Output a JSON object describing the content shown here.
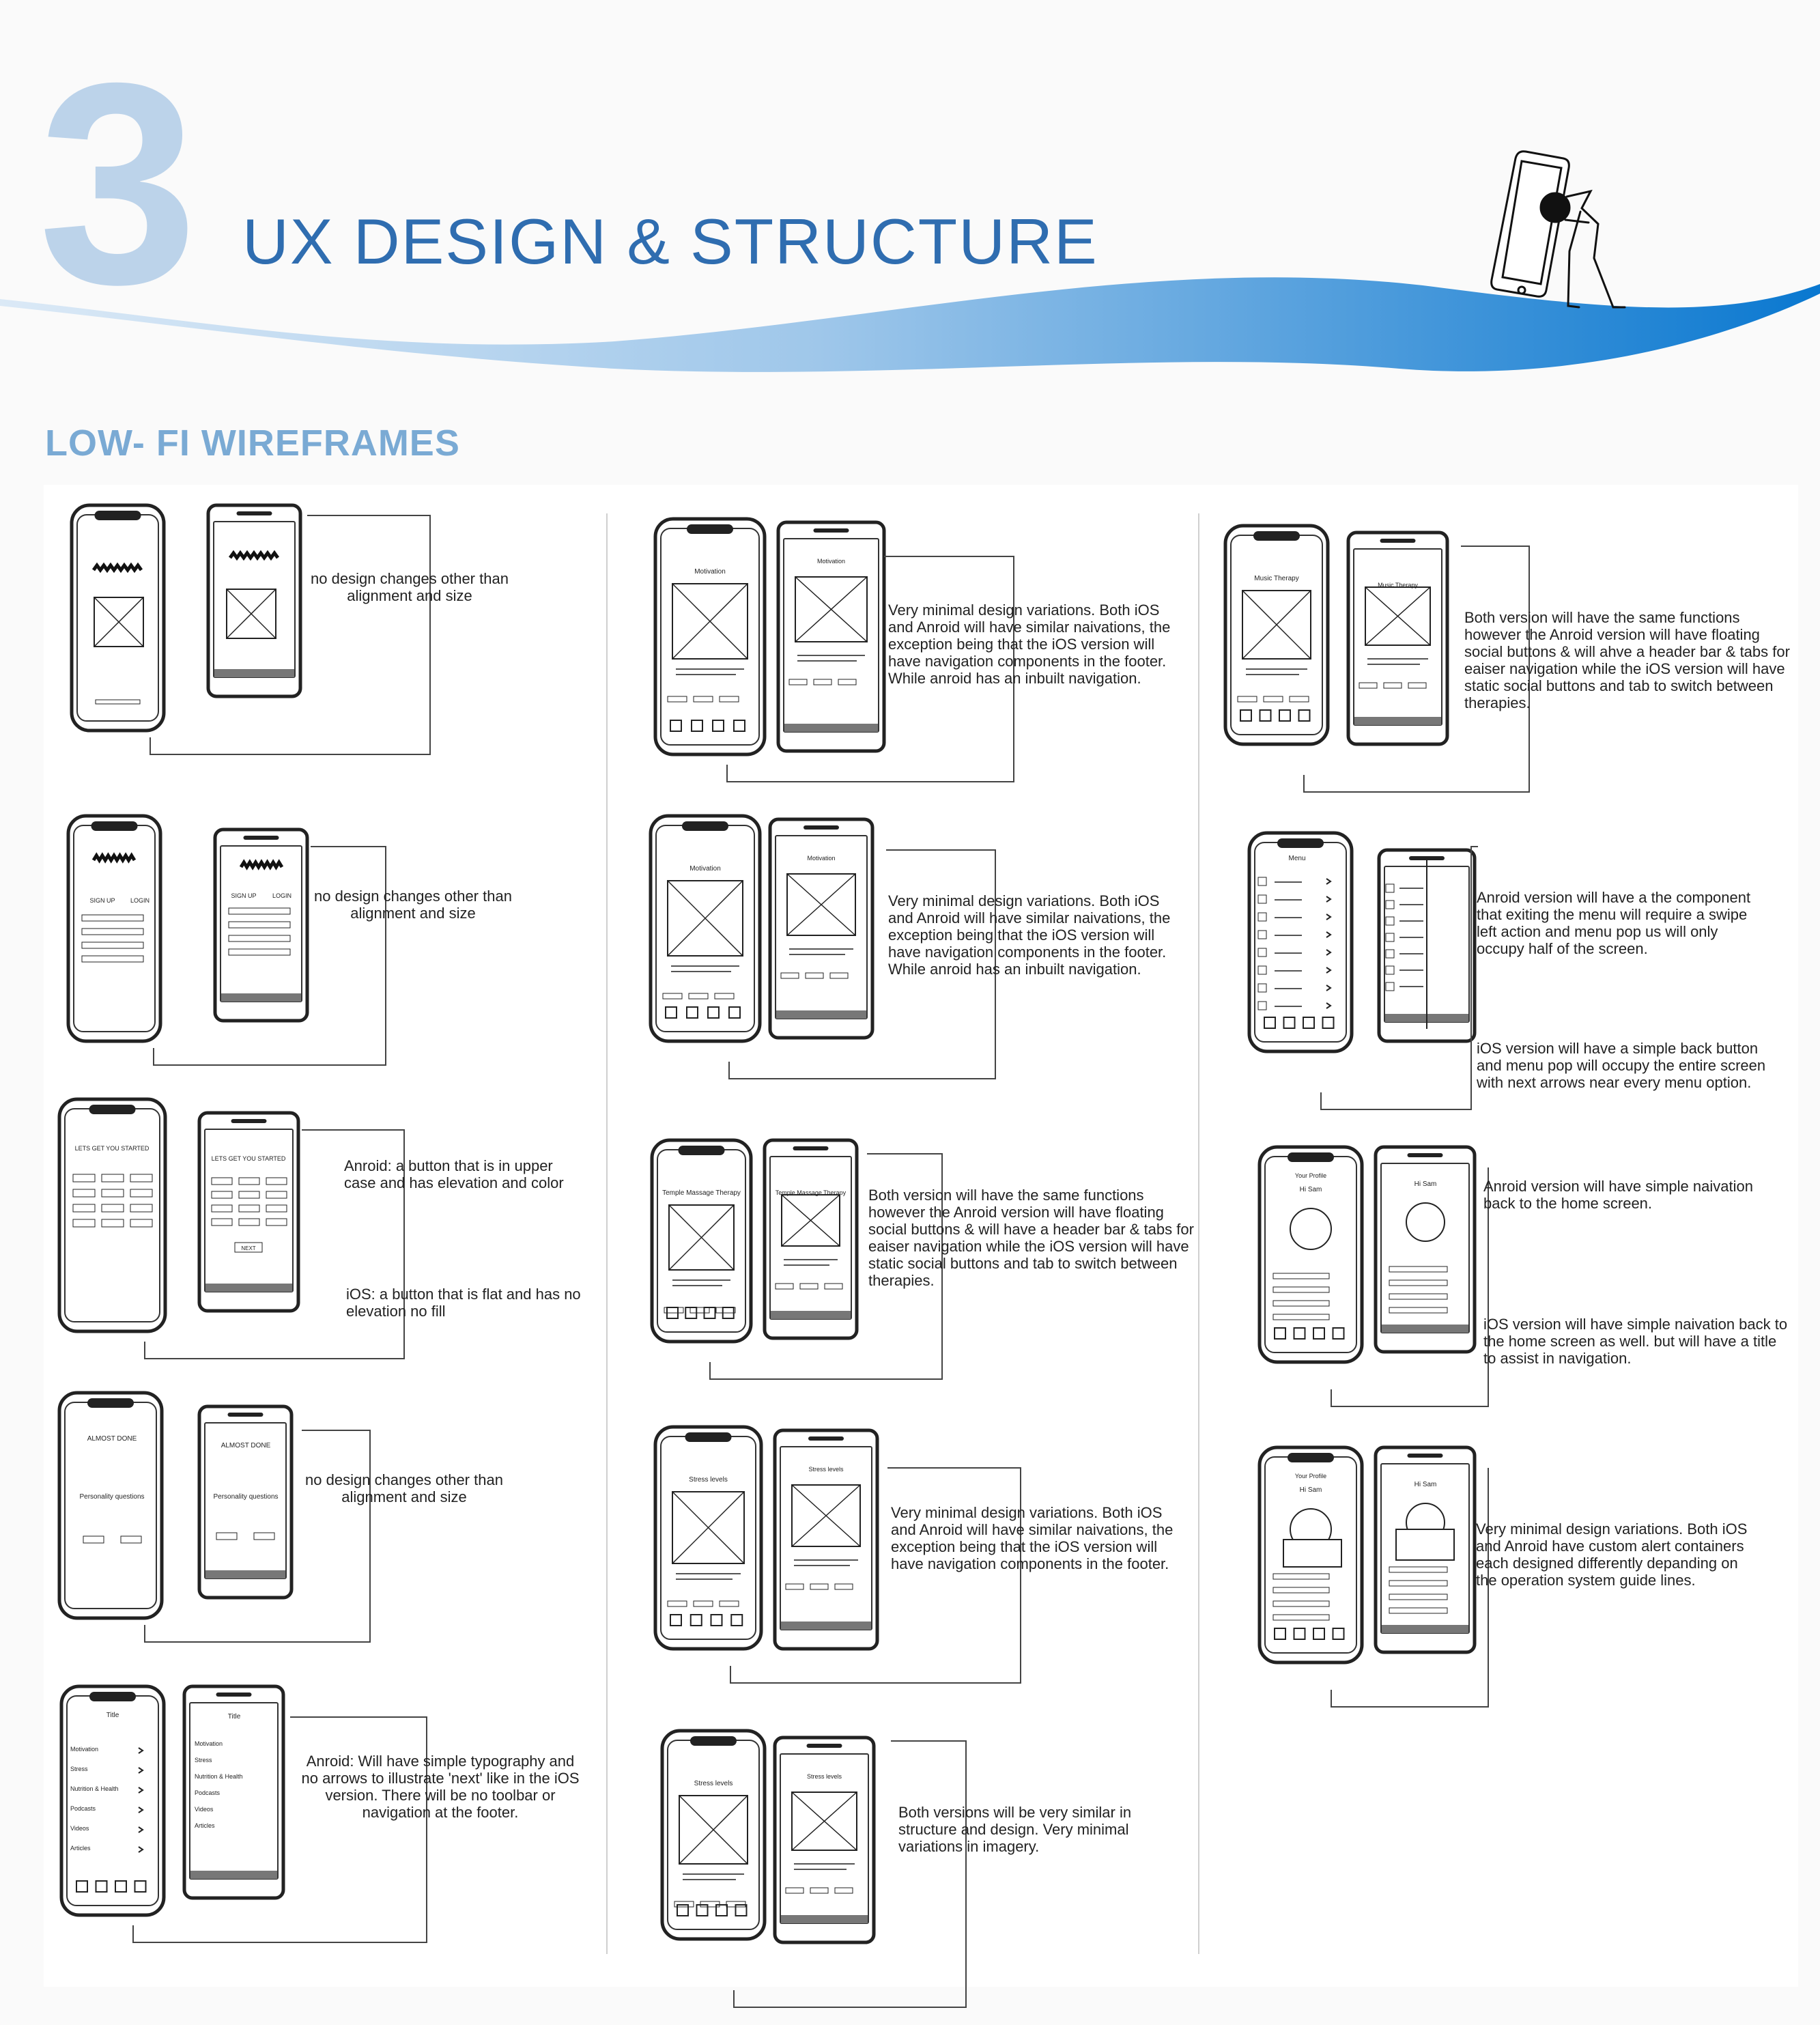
{
  "header": {
    "number": "3",
    "title": "UX DESIGN & STRUCTURE",
    "accent_color": "#1f7fd1",
    "number_color": "#bcd3ea",
    "title_color": "#2f6db0",
    "mascot_icon": "phone-sketch-figure-icon"
  },
  "section": {
    "heading": "LOW- FI WIREFRAMES",
    "heading_color": "#7aaad4"
  },
  "wireframes": [
    {
      "note": "no design changes other than alignment and size"
    },
    {
      "note": "no design changes other than alignment and size",
      "labels": {
        "sign_up": "SIGN UP",
        "login": "LOGIN"
      }
    },
    {
      "note_android": "Anroid: a button that is in upper case and has elevation and color",
      "note_ios": "iOS: a button that is flat and has no elevation no fill",
      "labels": {
        "heading": "LETS GET YOU STARTED",
        "next": "NEXT"
      }
    },
    {
      "note": "no design changes other than alignment and size",
      "labels": {
        "heading": "ALMOST DONE",
        "sub": "Personality questions"
      }
    },
    {
      "note": "Anroid: Will have simple typography and no arrows to illustrate 'next' like in the iOS version. There will be no toolbar or navigation at the footer.",
      "labels": {
        "title": "Title",
        "menu": [
          "Motivation",
          "Stress",
          "Nutrition & Health",
          "Podcasts",
          "Videos",
          "Articles"
        ]
      }
    },
    {
      "note": "Very minimal design variations. Both iOS and Anroid will have similar naivations, the exception being that the iOS version will have navigation components in the footer. While anroid has an inbuilt navigation.",
      "labels": {
        "title": "Motivation"
      }
    },
    {
      "note": "Very minimal design variations. Both iOS and Anroid will have similar naivations, the exception being that the iOS version will have navigation components in the footer. While anroid has an inbuilt navigation.",
      "labels": {
        "title": "Motivation"
      }
    },
    {
      "note": "Both version  will have the same functions however the Anroid version will have floating social buttons & will have a header bar & tabs for eaiser navigation while the iOS version will have static social buttons and tab to switch between therapies.",
      "labels": {
        "title": "Temple Massage Therapy"
      }
    },
    {
      "note": "Very minimal design variations. Both iOS and Anroid will have similar naivations, the exception being that the iOS version will have navigation components in the footer.",
      "labels": {
        "title": "Stress levels"
      }
    },
    {
      "note": "Both versions will be very similar in structure and design. Very minimal variations in imagery.",
      "labels": {
        "title": "Stress levels"
      }
    },
    {
      "note": "Both version  will have the same functions however the Anroid version will have floating social buttons & will ahve a header bar & tabs for eaiser navigation while the iOS version will have static social buttons and tab to switch between therapies.",
      "labels": {
        "title": "Music Therapy"
      }
    },
    {
      "note_android": "Anroid version will have a the component that exiting the menu will require a swipe left action and menu pop us will only occupy half of the screen.",
      "note_ios": "iOS version will have a simple back button and menu pop will occupy the entire screen with next arrows near every menu option.",
      "labels": {
        "title": "Menu"
      }
    },
    {
      "note_android": "Anroid version will have simple naivation back to the home screen.",
      "note_ios": "iOS version will have simple naivation back to the home screen as well. but will have a title to assist in navigation.",
      "labels": {
        "title": "Your Profile",
        "greeting": "Hi Sam"
      }
    },
    {
      "note": "Very minimal design variations. Both iOS and Anroid have custom alert containers each designed differently depanding on the operation system guide lines.",
      "labels": {
        "title": "Your Profile",
        "greeting": "Hi Sam"
      }
    }
  ]
}
